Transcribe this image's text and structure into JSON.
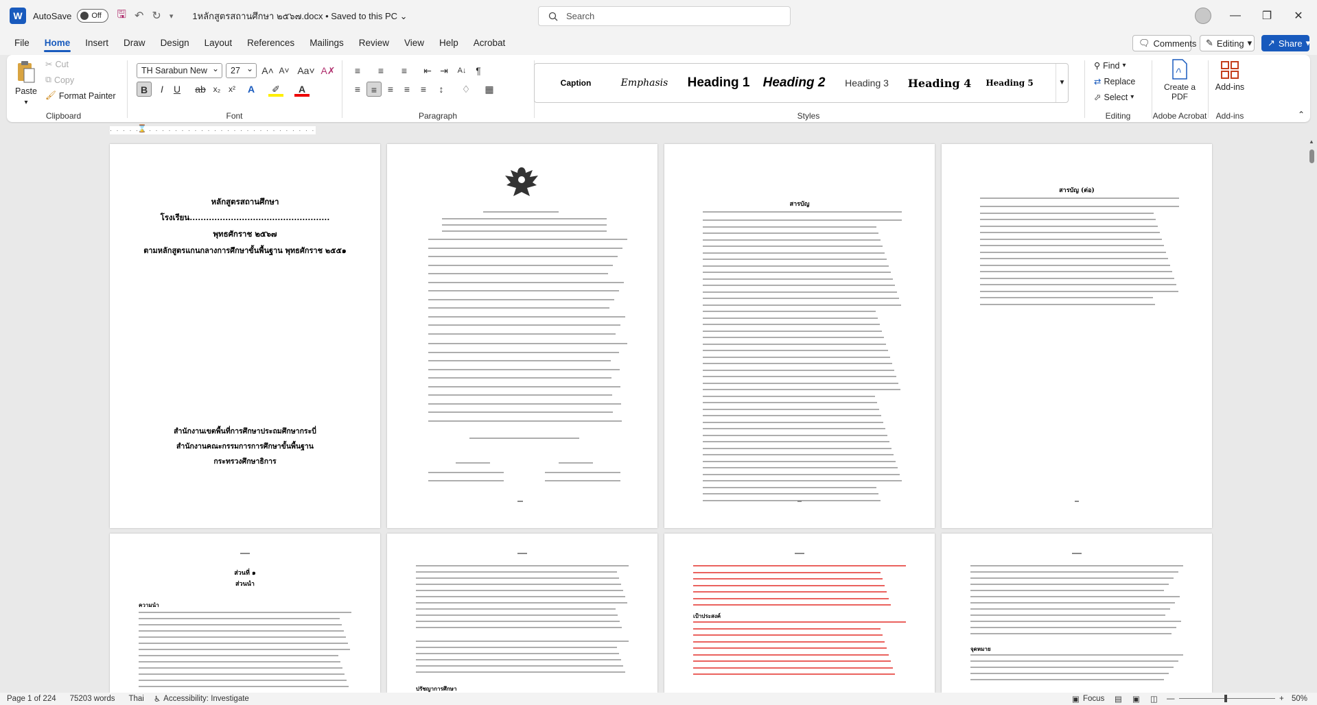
{
  "titlebar": {
    "autosave_label": "AutoSave",
    "autosave_state": "Off",
    "doc_title": "1หลักสูตรสถานศึกษา ๒๕๖๗.docx • Saved to this PC ⌄",
    "search_placeholder": "Search"
  },
  "menu": {
    "items": [
      "File",
      "Home",
      "Insert",
      "Draw",
      "Design",
      "Layout",
      "References",
      "Mailings",
      "Review",
      "View",
      "Help",
      "Acrobat"
    ],
    "comments": "Comments",
    "editing": "Editing",
    "share": "Share"
  },
  "ribbon": {
    "clipboard": {
      "paste": "Paste",
      "cut": "Cut",
      "copy": "Copy",
      "format_painter": "Format Painter",
      "label": "Clipboard"
    },
    "font": {
      "name": "TH Sarabun New",
      "size": "27",
      "label": "Font"
    },
    "paragraph": {
      "label": "Paragraph"
    },
    "styles": {
      "items": [
        "Caption",
        "Emphasis",
        "Heading 1",
        "Heading 2",
        "Heading 3",
        "Heading 4",
        "Heading 5"
      ],
      "label": "Styles"
    },
    "editing": {
      "find": "Find",
      "replace": "Replace",
      "select": "Select",
      "label": "Editing"
    },
    "acrobat": {
      "create_pdf": "Create a PDF",
      "label": "Adobe Acrobat"
    },
    "addins": {
      "button": "Add-ins",
      "label": "Add-ins"
    }
  },
  "pages": {
    "p1": {
      "title": "หลักสูตรสถานศึกษา",
      "school": "โรงเรียน...................................................",
      "year": "พุทธศักราช ๒๕๖๗",
      "basis": "ตามหลักสูตรแกนกลางการศึกษาขั้นพื้นฐาน พุทธศักราช ๒๕๕๑",
      "office1": "สำนักงานเขตพื้นที่การศึกษาประถมศึกษากระบี่",
      "office2": "สำนักงานคณะกรรมการการศึกษาขั้นพื้นฐาน",
      "office3": "กระทรวงศึกษาธิการ"
    },
    "p3_title": "สารบัญ",
    "p4_title": "สารบัญ (ต่อ)",
    "p5": {
      "part": "ส่วนที่ ๑",
      "part_name": "ส่วนนำ",
      "section": "ความนำ"
    },
    "p7": {
      "section": "เป้าประสงค์"
    },
    "p6": {
      "section": "ปรัชญาการศึกษา"
    },
    "p8": {
      "section": "จุดหมาย"
    }
  },
  "status": {
    "page": "Page 1 of 224",
    "words": "75203 words",
    "lang": "Thai",
    "accessibility": "Accessibility: Investigate",
    "focus": "Focus",
    "zoom": "50%"
  }
}
